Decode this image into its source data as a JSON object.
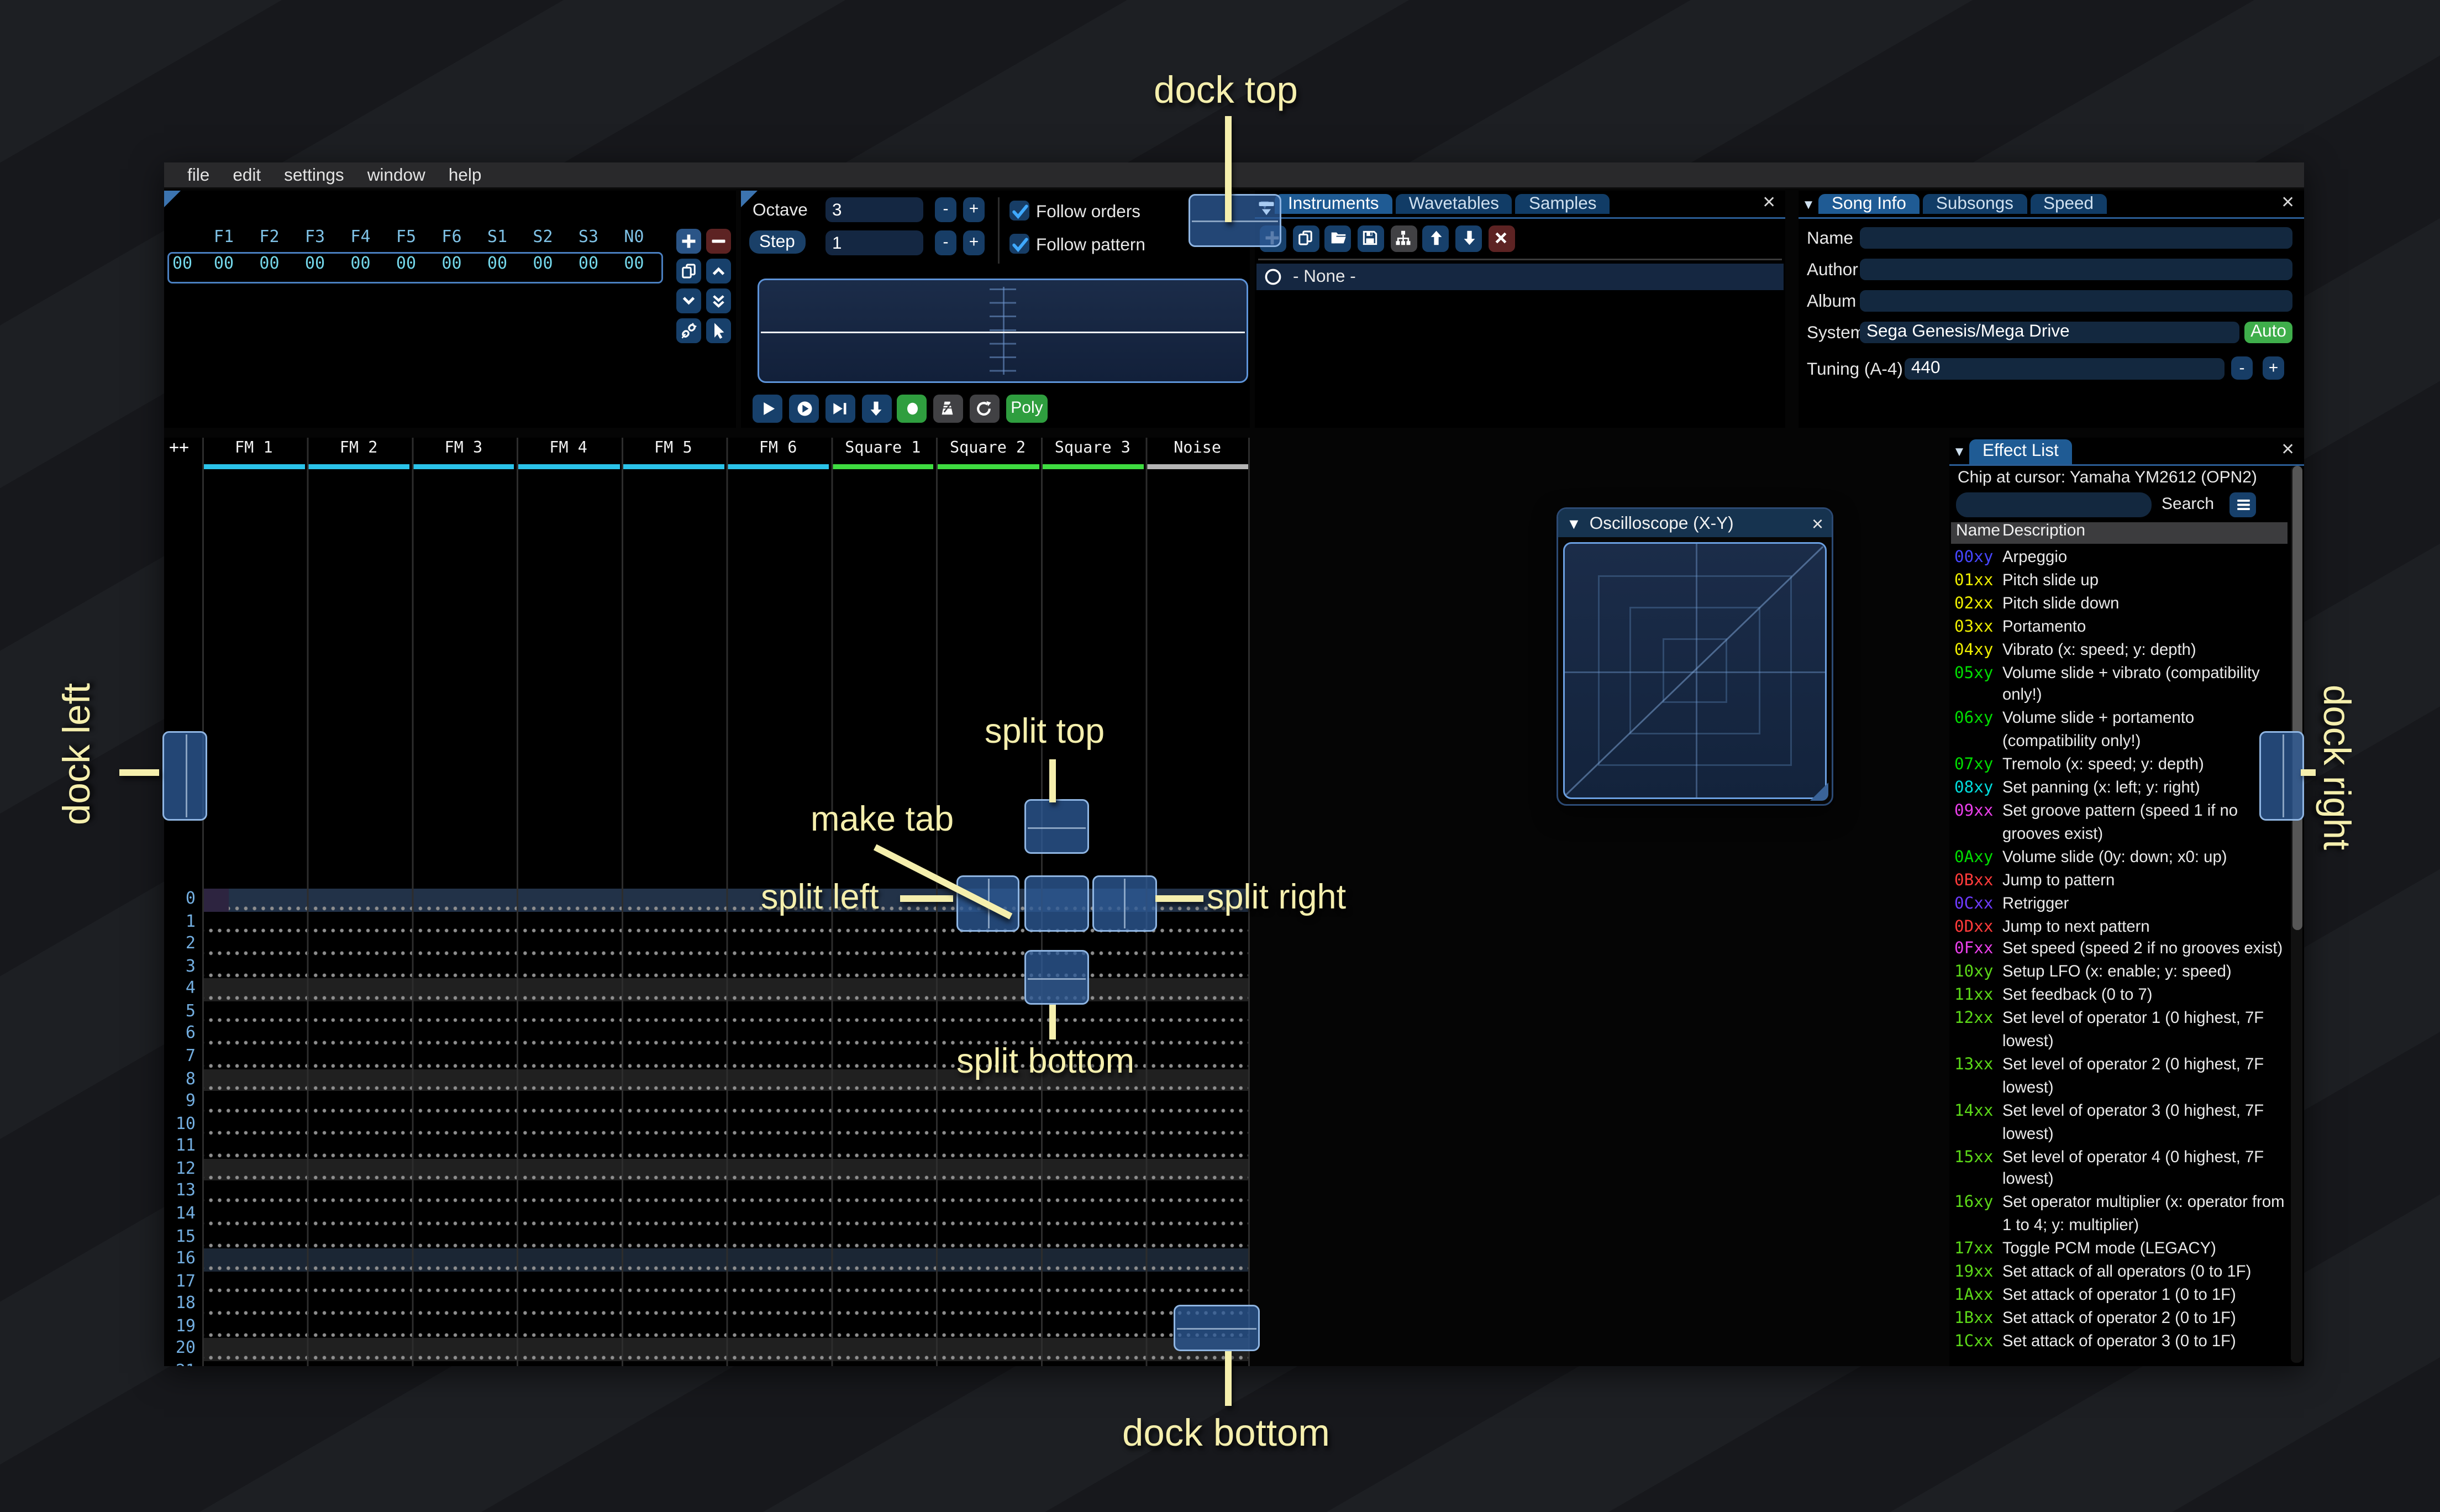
{
  "window": {
    "menu": [
      "file",
      "edit",
      "settings",
      "window",
      "help"
    ]
  },
  "orders": {
    "columns": [
      "F1",
      "F2",
      "F3",
      "F4",
      "F5",
      "F6",
      "S1",
      "S2",
      "S3",
      "N0"
    ],
    "rows": [
      {
        "index": "00",
        "values": [
          "00",
          "00",
          "00",
          "00",
          "00",
          "00",
          "00",
          "00",
          "00",
          "00"
        ]
      }
    ],
    "buttons": [
      {
        "name": "add-order-button",
        "icon": "plus",
        "style": "bg-bluebr"
      },
      {
        "name": "remove-order-button",
        "icon": "minus",
        "style": "bg-red"
      },
      {
        "name": "duplicate-order-button",
        "icon": "copy",
        "style": "bg-blue"
      },
      {
        "name": "move-order-up-button",
        "icon": "chevron-up",
        "style": "bg-blue"
      },
      {
        "name": "move-order-down-button",
        "icon": "chevron-down",
        "style": "bg-blue"
      },
      {
        "name": "order-change-all-button",
        "icon": "dbl-chevron-down",
        "style": "bg-blue"
      },
      {
        "name": "order-deep-clone-button",
        "icon": "unlink",
        "style": "bg-blue"
      },
      {
        "name": "order-edit-mode-button",
        "icon": "cursor",
        "style": "bg-blue"
      }
    ]
  },
  "controls": {
    "octave_label": "Octave",
    "octave_value": "3",
    "step_label": "Step",
    "step_value": "1",
    "dec_label": "-",
    "inc_label": "+",
    "follow_orders_label": "Follow orders",
    "follow_pattern_label": "Follow pattern",
    "transport": [
      {
        "name": "play-button",
        "icon": "play",
        "style": "bg-blue"
      },
      {
        "name": "play-from-cursor-button",
        "icon": "play-circle",
        "style": "bg-blue"
      },
      {
        "name": "play-pattern-button",
        "icon": "play-bar",
        "style": "bg-blue"
      },
      {
        "name": "step-one-row-button",
        "icon": "arrow-down",
        "style": "bg-blue"
      },
      {
        "name": "record-button",
        "icon": "record",
        "style": "bg-green"
      },
      {
        "name": "metronome-button",
        "icon": "metronome",
        "style": "bg-gray"
      },
      {
        "name": "repeat-pattern-button",
        "icon": "repeat",
        "style": "bg-gray"
      }
    ],
    "poly_label": "Poly"
  },
  "instruments": {
    "tabs": [
      {
        "label": "Instruments",
        "active": true
      },
      {
        "label": "Wavetables",
        "active": false
      },
      {
        "label": "Samples",
        "active": false
      }
    ],
    "toolbar": [
      {
        "name": "add-instrument-button",
        "icon": "plus",
        "style": "bg-blue"
      },
      {
        "name": "duplicate-instrument-button",
        "icon": "copy",
        "style": "bg-blue"
      },
      {
        "name": "open-instrument-button",
        "icon": "folder",
        "style": "bg-blue"
      },
      {
        "name": "save-instrument-button",
        "icon": "floppy",
        "style": "bg-blue"
      },
      {
        "name": "instrument-folder-view-button",
        "icon": "tree",
        "style": "bg-gray"
      },
      {
        "name": "move-instrument-up-button",
        "icon": "arrow-up",
        "style": "bg-blue"
      },
      {
        "name": "move-instrument-down-button",
        "icon": "arrow-down",
        "style": "bg-blue"
      },
      {
        "name": "delete-instrument-button",
        "icon": "x",
        "style": "bg-red"
      }
    ],
    "list": [
      {
        "label": "- None -",
        "selected": true
      }
    ]
  },
  "song_info": {
    "tabs": [
      {
        "label": "Song Info",
        "active": true
      },
      {
        "label": "Subsongs",
        "active": false
      },
      {
        "label": "Speed",
        "active": false
      }
    ],
    "name_label": "Name",
    "name_value": "",
    "author_label": "Author",
    "author_value": "",
    "album_label": "Album",
    "album_value": "",
    "system_label": "System",
    "system_value": "Sega Genesis/Mega Drive",
    "auto_label": "Auto",
    "tuning_label": "Tuning (A-4)",
    "tuning_value": "440"
  },
  "effect_list": {
    "tab_label": "Effect List",
    "chip_line": "Chip at cursor: Yamaha YM2612 (OPN2)",
    "search_value": "",
    "search_label": "Search",
    "name_column": "Name",
    "description_column": "Description",
    "rows": [
      {
        "code": "00xy",
        "color": "#4646ff",
        "desc": "Arpeggio"
      },
      {
        "code": "01xx",
        "color": "#eded00",
        "desc": "Pitch slide up"
      },
      {
        "code": "02xx",
        "color": "#eded00",
        "desc": "Pitch slide down"
      },
      {
        "code": "03xx",
        "color": "#eded00",
        "desc": "Portamento"
      },
      {
        "code": "04xy",
        "color": "#eded00",
        "desc": "Vibrato (x: speed; y: depth)"
      },
      {
        "code": "05xy",
        "color": "#00dc00",
        "desc": "Volume slide + vibrato (compatibility only!)"
      },
      {
        "code": "06xy",
        "color": "#00dc00",
        "desc": "Volume slide + portamento (compatibility only!)"
      },
      {
        "code": "07xy",
        "color": "#00dc00",
        "desc": "Tremolo (x: speed; y: depth)"
      },
      {
        "code": "08xy",
        "color": "#00dcdc",
        "desc": "Set panning (x: left; y: right)"
      },
      {
        "code": "09xx",
        "color": "#e93fe9",
        "desc": "Set groove pattern (speed 1 if no grooves exist)"
      },
      {
        "code": "0Axy",
        "color": "#00dc00",
        "desc": "Volume slide (0y: down; x0: up)"
      },
      {
        "code": "0Bxx",
        "color": "#ff3b3b",
        "desc": "Jump to pattern"
      },
      {
        "code": "0Cxx",
        "color": "#6e3bff",
        "desc": "Retrigger"
      },
      {
        "code": "0Dxx",
        "color": "#ff3b3b",
        "desc": "Jump to next pattern"
      },
      {
        "code": "0Fxx",
        "color": "#e93fe9",
        "desc": "Set speed (speed 2 if no grooves exist)"
      },
      {
        "code": "10xy",
        "color": "#5bd718",
        "desc": "Setup LFO (x: enable; y: speed)"
      },
      {
        "code": "11xx",
        "color": "#5bd718",
        "desc": "Set feedback (0 to 7)"
      },
      {
        "code": "12xx",
        "color": "#5bd718",
        "desc": "Set level of operator 1 (0 highest, 7F lowest)"
      },
      {
        "code": "13xx",
        "color": "#5bd718",
        "desc": "Set level of operator 2 (0 highest, 7F lowest)"
      },
      {
        "code": "14xx",
        "color": "#5bd718",
        "desc": "Set level of operator 3 (0 highest, 7F lowest)"
      },
      {
        "code": "15xx",
        "color": "#5bd718",
        "desc": "Set level of operator 4 (0 highest, 7F lowest)"
      },
      {
        "code": "16xy",
        "color": "#5bd718",
        "desc": "Set operator multiplier (x: operator from 1 to 4; y: multiplier)"
      },
      {
        "code": "17xx",
        "color": "#5bd718",
        "desc": "Toggle PCM mode (LEGACY)"
      },
      {
        "code": "19xx",
        "color": "#5bd718",
        "desc": "Set attack of all operators (0 to 1F)"
      },
      {
        "code": "1Axx",
        "color": "#5bd718",
        "desc": "Set attack of operator 1 (0 to 1F)"
      },
      {
        "code": "1Bxx",
        "color": "#5bd718",
        "desc": "Set attack of operator 2 (0 to 1F)"
      },
      {
        "code": "1Cxx",
        "color": "#5bd718",
        "desc": "Set attack of operator 3 (0 to 1F)"
      }
    ]
  },
  "pattern": {
    "corner_label": "++",
    "channels": [
      {
        "name": "FM 1",
        "color": "#2bc3e9"
      },
      {
        "name": "FM 2",
        "color": "#2bc3e9"
      },
      {
        "name": "FM 3",
        "color": "#2bc3e9"
      },
      {
        "name": "FM 4",
        "color": "#2bc3e9"
      },
      {
        "name": "FM 5",
        "color": "#2bc3e9"
      },
      {
        "name": "FM 6",
        "color": "#2bc3e9"
      },
      {
        "name": "Square 1",
        "color": "#3fdc41"
      },
      {
        "name": "Square 2",
        "color": "#3fdc41"
      },
      {
        "name": "Square 3",
        "color": "#3fdc41"
      },
      {
        "name": "Noise",
        "color": "#b5b5b5"
      }
    ],
    "row_count": 22,
    "selected_row": 0,
    "highlight_major": [
      16
    ],
    "highlight_minor": [
      4,
      8,
      12,
      20
    ]
  },
  "oscilloscope": {
    "title": "Oscilloscope (X-Y)"
  },
  "overlay": {
    "dock_top": "dock top",
    "dock_bottom": "dock bottom",
    "dock_left": "dock left",
    "dock_right": "dock right",
    "split_top": "split top",
    "split_bottom": "split bottom",
    "split_left": "split left",
    "split_right": "split right",
    "make_tab": "make tab",
    "accent": "#2d5f9b",
    "label_color": "#f5efad"
  }
}
